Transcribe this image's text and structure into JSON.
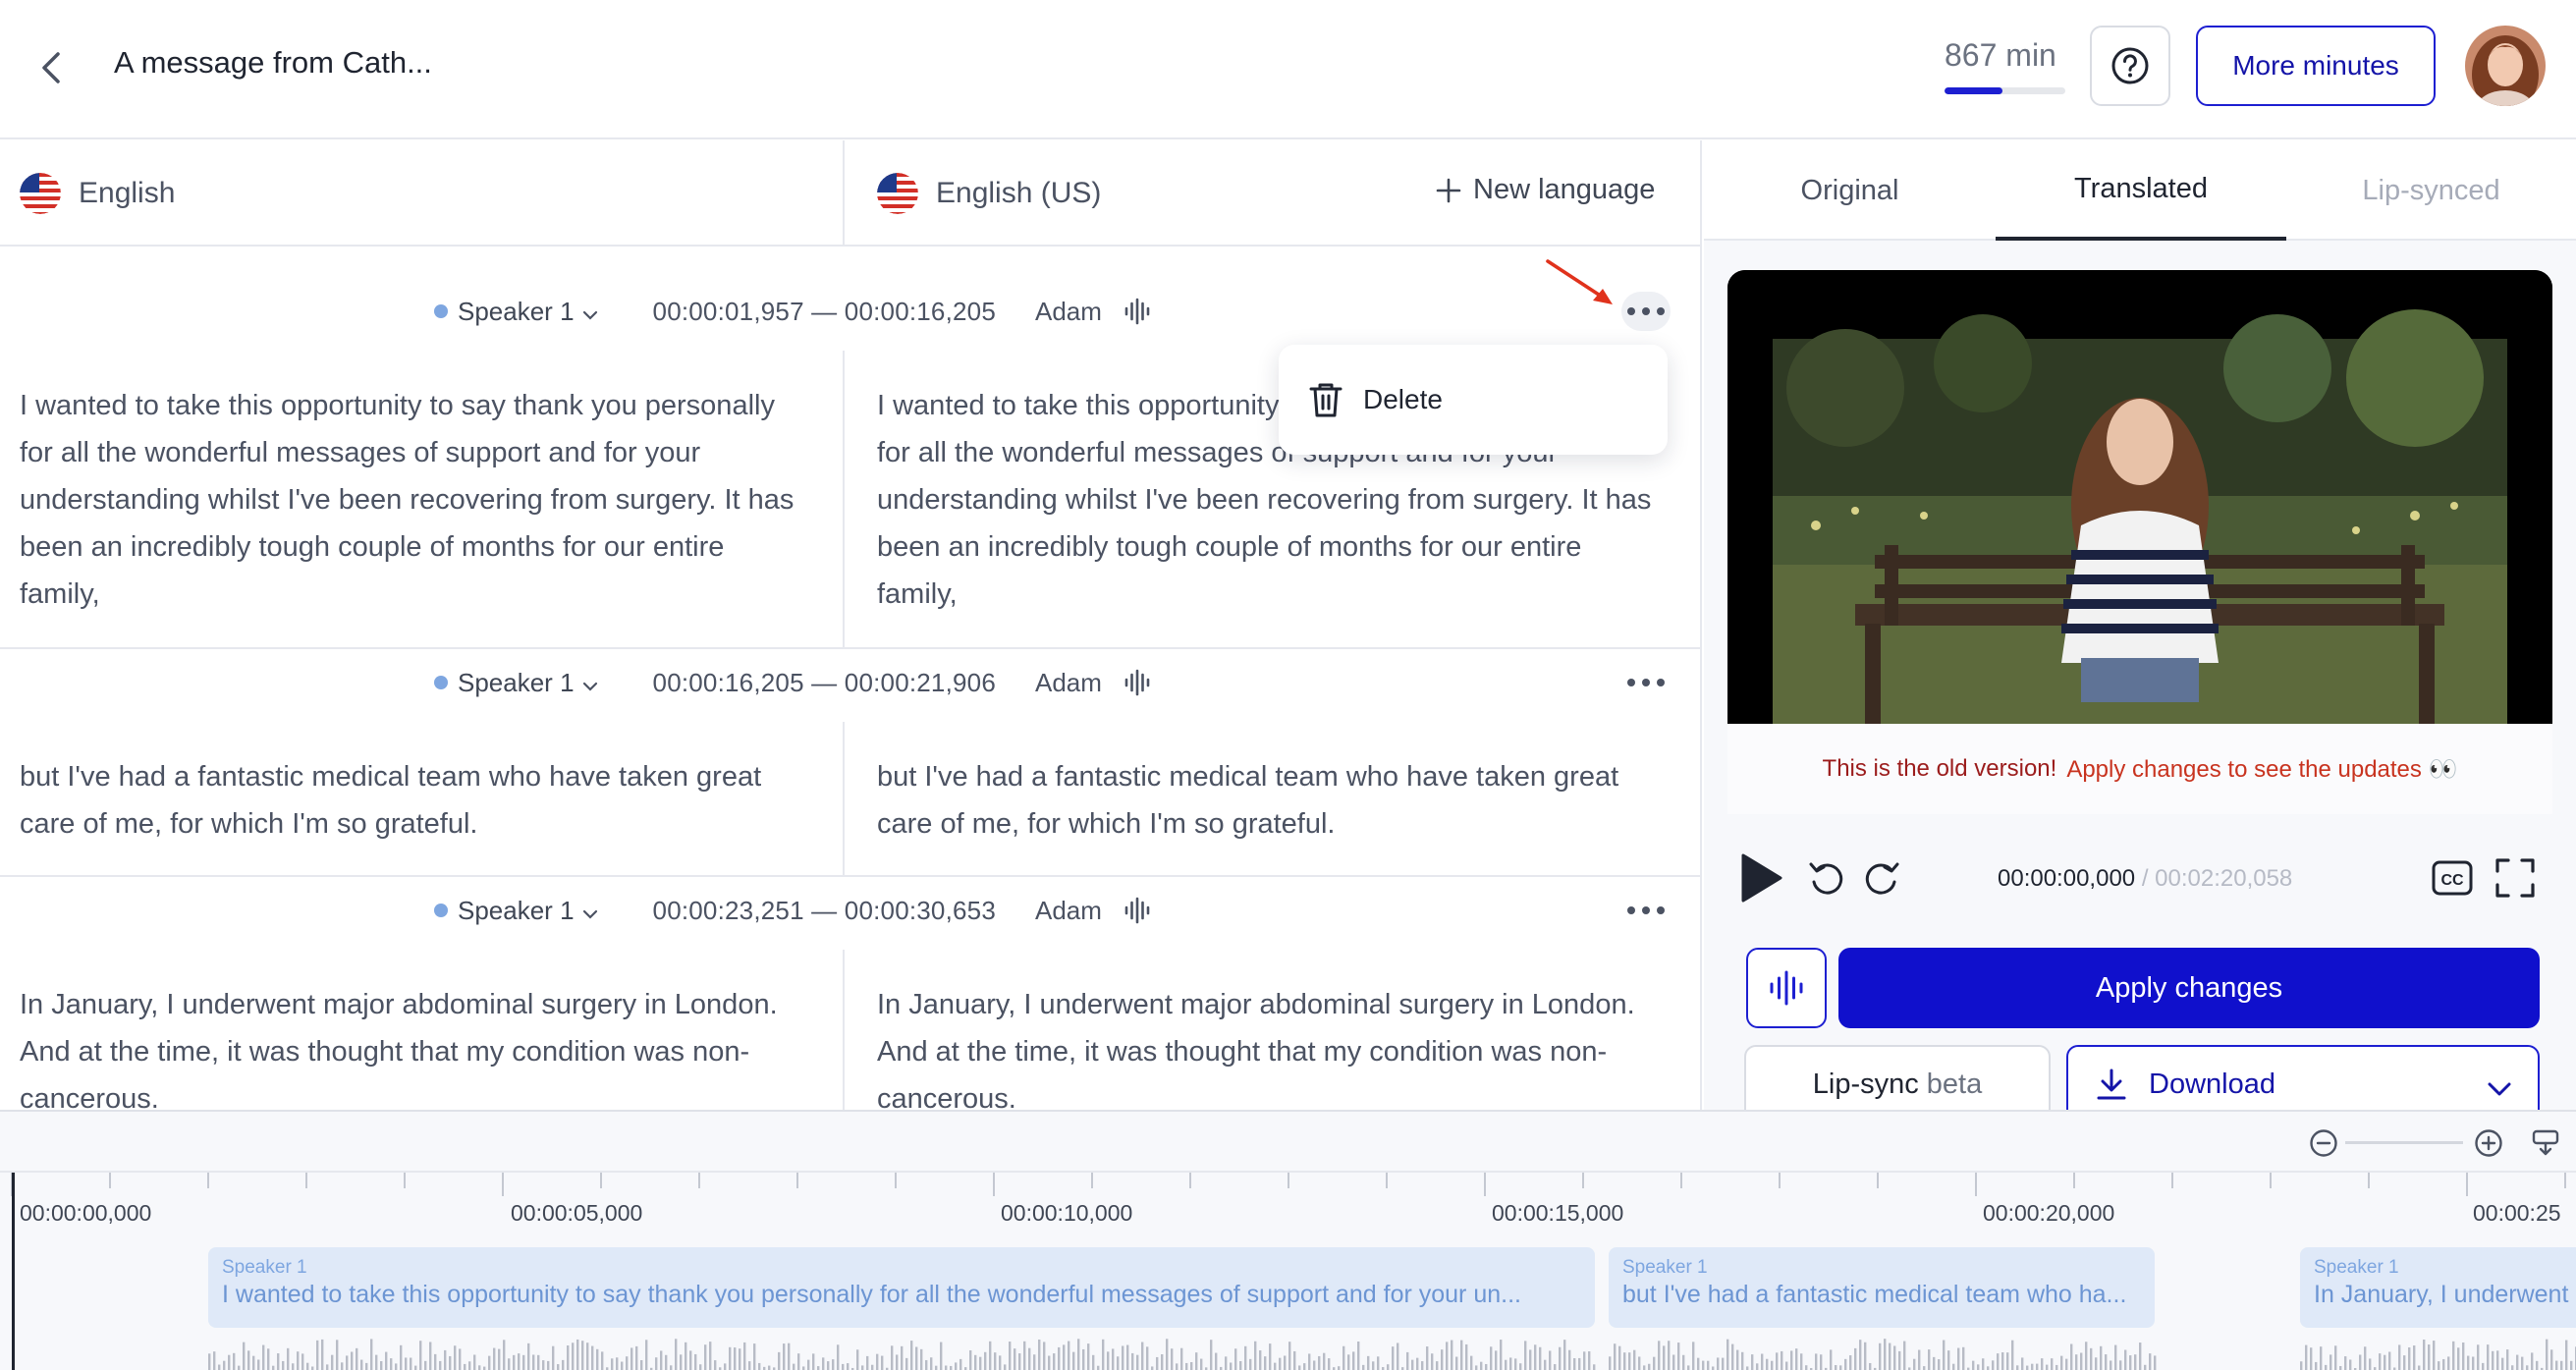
{
  "header": {
    "title": "A message from Cath...",
    "minutes_label": "867 min",
    "minutes_progress_percent": 48,
    "more_minutes_label": "More minutes"
  },
  "languages": {
    "source": "English",
    "target": "English (US)",
    "new_language_label": "New language"
  },
  "segments": [
    {
      "speaker": "Speaker 1",
      "time_range": "00:00:01,957 — 00:00:16,205",
      "voice": "Adam",
      "source_text": "I wanted to take this opportunity to say thank you personally for all the wonderful messages of support and for your understanding whilst I've been recovering from surgery. It has been an incredibly tough couple of months for our entire family,",
      "target_text": "I wanted to take this opportunity to say thank you personally for all the wonderful messages of support and for your understanding whilst I've been recovering from surgery. It has been an incredibly tough couple of months for our entire family,"
    },
    {
      "speaker": "Speaker 1",
      "time_range": "00:00:16,205 — 00:00:21,906",
      "voice": "Adam",
      "source_text": "but I've had a fantastic medical team who have taken great care of me, for which I'm so grateful.",
      "target_text": "but I've had a fantastic medical team who have taken great care of me, for which I'm so grateful."
    },
    {
      "speaker": "Speaker 1",
      "time_range": "00:00:23,251 — 00:00:30,653",
      "voice": "Adam",
      "source_text": "In January, I underwent major abdominal surgery in London. And at the time, it was thought that my condition was non-cancerous.",
      "target_text": "In January, I underwent major abdominal surgery in London. And at the time, it was thought that my condition was non-cancerous."
    }
  ],
  "context_menu": {
    "delete_label": "Delete"
  },
  "right_panel": {
    "tabs": [
      "Original",
      "Translated",
      "Lip-synced"
    ],
    "active_tab": "Translated",
    "notice_part1": "This is the old version!",
    "notice_part2": "Apply changes to see the updates 👀",
    "current_time": "00:00:00,000",
    "total_time": "/ 00:02:20,058",
    "apply_label": "Apply changes",
    "lipsync_label": "Lip-sync",
    "lipsync_badge": "beta",
    "download_label": "Download"
  },
  "timeline": {
    "ticks": [
      "00:00:00,000",
      "00:00:05,000",
      "00:00:10,000",
      "00:00:15,000",
      "00:00:20,000",
      "00:00:25"
    ],
    "clips": [
      {
        "speaker": "Speaker 1",
        "text": "I wanted to take this opportunity to say thank you personally for all the wonderful messages of support and for your un..."
      },
      {
        "speaker": "Speaker 1",
        "text": "but I've had a fantastic medical team who ha..."
      },
      {
        "speaker": "Speaker 1",
        "text": "In January, I underwent"
      }
    ]
  },
  "colors": {
    "accent": "#1010cc",
    "speaker_dot": "#7ea6e0",
    "warning_dark": "#9b1c1c",
    "warning": "#c8331f"
  }
}
